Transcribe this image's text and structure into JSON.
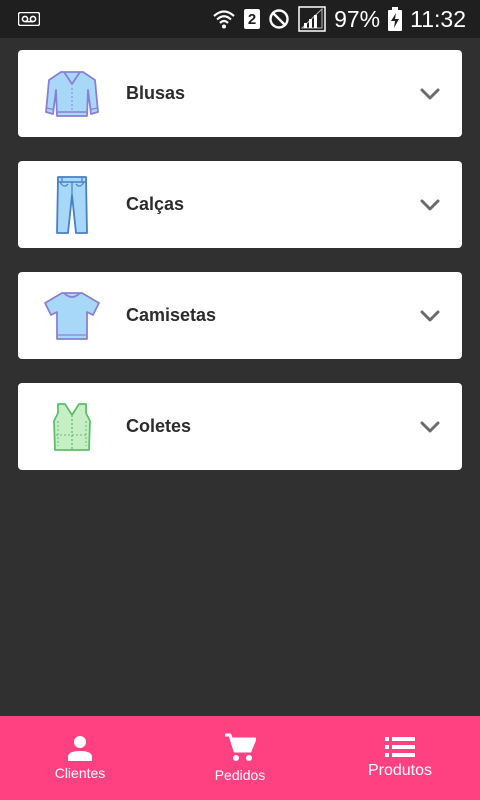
{
  "status_bar": {
    "sim_number": "2",
    "battery_percent": "97%",
    "time": "11:32",
    "icons": [
      "voicemail-icon",
      "wifi-icon",
      "sim-icon",
      "do-not-disturb-icon",
      "signal-icon",
      "battery-charging-icon"
    ]
  },
  "categories": [
    {
      "label": "Blusas",
      "icon": "sweater-icon"
    },
    {
      "label": "Calças",
      "icon": "jeans-icon"
    },
    {
      "label": "Camisetas",
      "icon": "tshirt-icon"
    },
    {
      "label": "Coletes",
      "icon": "vest-icon"
    }
  ],
  "bottom_nav": {
    "items": [
      {
        "label": "Clientes",
        "icon": "person-icon"
      },
      {
        "label": "Pedidos",
        "icon": "cart-icon"
      },
      {
        "label": "Produtos",
        "icon": "list-icon"
      }
    ],
    "active": "Produtos"
  },
  "colors": {
    "background": "#303030",
    "card": "#ffffff",
    "accent": "#ff4081",
    "status_bar": "#1f1f1f"
  }
}
